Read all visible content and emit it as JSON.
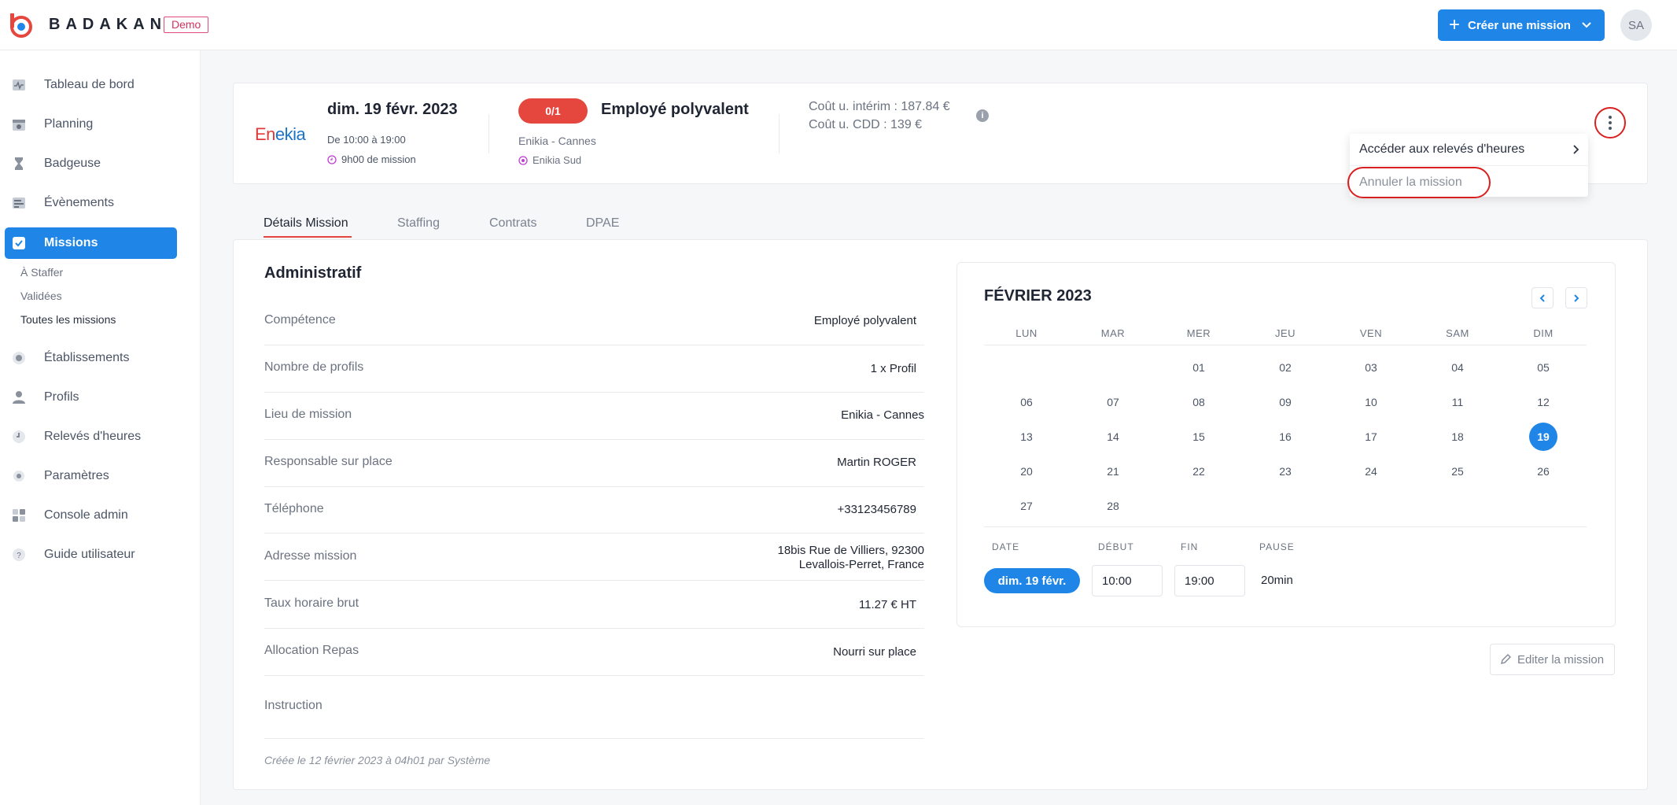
{
  "header": {
    "brand": "BADAKAN",
    "demo_badge": "Demo",
    "create_button": "Créer une mission",
    "avatar_initials": "SA"
  },
  "sidebar": {
    "items": [
      {
        "label": "Tableau de bord",
        "icon": "pulse-icon"
      },
      {
        "label": "Planning",
        "icon": "calendar-star-icon"
      },
      {
        "label": "Badgeuse",
        "icon": "hourglass-icon"
      },
      {
        "label": "Évènements",
        "icon": "timeline-icon"
      },
      {
        "label": "Missions",
        "icon": "checkbox-icon",
        "active": true
      },
      {
        "label": "Établissements",
        "icon": "building-icon"
      },
      {
        "label": "Profils",
        "icon": "user-icon"
      },
      {
        "label": "Relevés d'heures",
        "icon": "clock-icon"
      },
      {
        "label": "Paramètres",
        "icon": "gear-icon"
      },
      {
        "label": "Console admin",
        "icon": "grid-icon"
      },
      {
        "label": "Guide utilisateur",
        "icon": "help-icon"
      }
    ],
    "sub_items": [
      "À Staffer",
      "Validées",
      "Toutes les missions"
    ]
  },
  "mission": {
    "client_logo_prefix": "En",
    "client_logo_suffix": "ekia",
    "date": "dim. 19 févr. 2023",
    "hours": "De 10:00 à 19:00",
    "duration": "9h00 de mission",
    "staffing": "0/1",
    "title": "Employé polyvalent",
    "place": "Enikia - Cannes",
    "site": "Enikia Sud",
    "cost_interim": "Coût u. intérim : 187.84 €",
    "cost_cdd": "Coût u. CDD : 139 €"
  },
  "menu": {
    "item1": "Accéder aux relevés d'heures",
    "item2": "Annuler la mission"
  },
  "tabs": [
    "Détails Mission",
    "Staffing",
    "Contrats",
    "DPAE"
  ],
  "admin": {
    "title": "Administratif",
    "rows": [
      {
        "label": "Compétence",
        "value": "Employé polyvalent"
      },
      {
        "label": "Nombre de profils",
        "value": "1 x Profil"
      },
      {
        "label": "Lieu de mission",
        "value": "Enikia - Cannes"
      },
      {
        "label": "Responsable sur place",
        "value": "Martin ROGER"
      },
      {
        "label": "Téléphone",
        "value": "+33123456789"
      },
      {
        "label": "Adresse mission",
        "value_line1": "18bis Rue de Villiers, 92300",
        "value_line2": "Levallois-Perret, France"
      },
      {
        "label": "Taux horaire brut",
        "value": "11.27 € HT"
      },
      {
        "label": "Allocation Repas",
        "value": "Nourri sur place"
      },
      {
        "label": "Instruction",
        "value": ""
      }
    ],
    "created": "Créée le 12 février 2023 à 04h01 par Système"
  },
  "calendar": {
    "title": "FÉVRIER 2023",
    "dow": [
      "LUN",
      "MAR",
      "MER",
      "JEU",
      "VEN",
      "SAM",
      "DIM"
    ],
    "selected_day": "19",
    "schedule_headers": [
      "DATE",
      "DÉBUT",
      "FIN",
      "PAUSE"
    ],
    "date_pill": "dim. 19 févr.",
    "start": "10:00",
    "end": "19:00",
    "pause": "20min",
    "edit_button": "Editer la mission"
  },
  "colors": {
    "primary": "#1f86e8",
    "danger": "#e5473f",
    "highlight_ring": "#d92020"
  }
}
